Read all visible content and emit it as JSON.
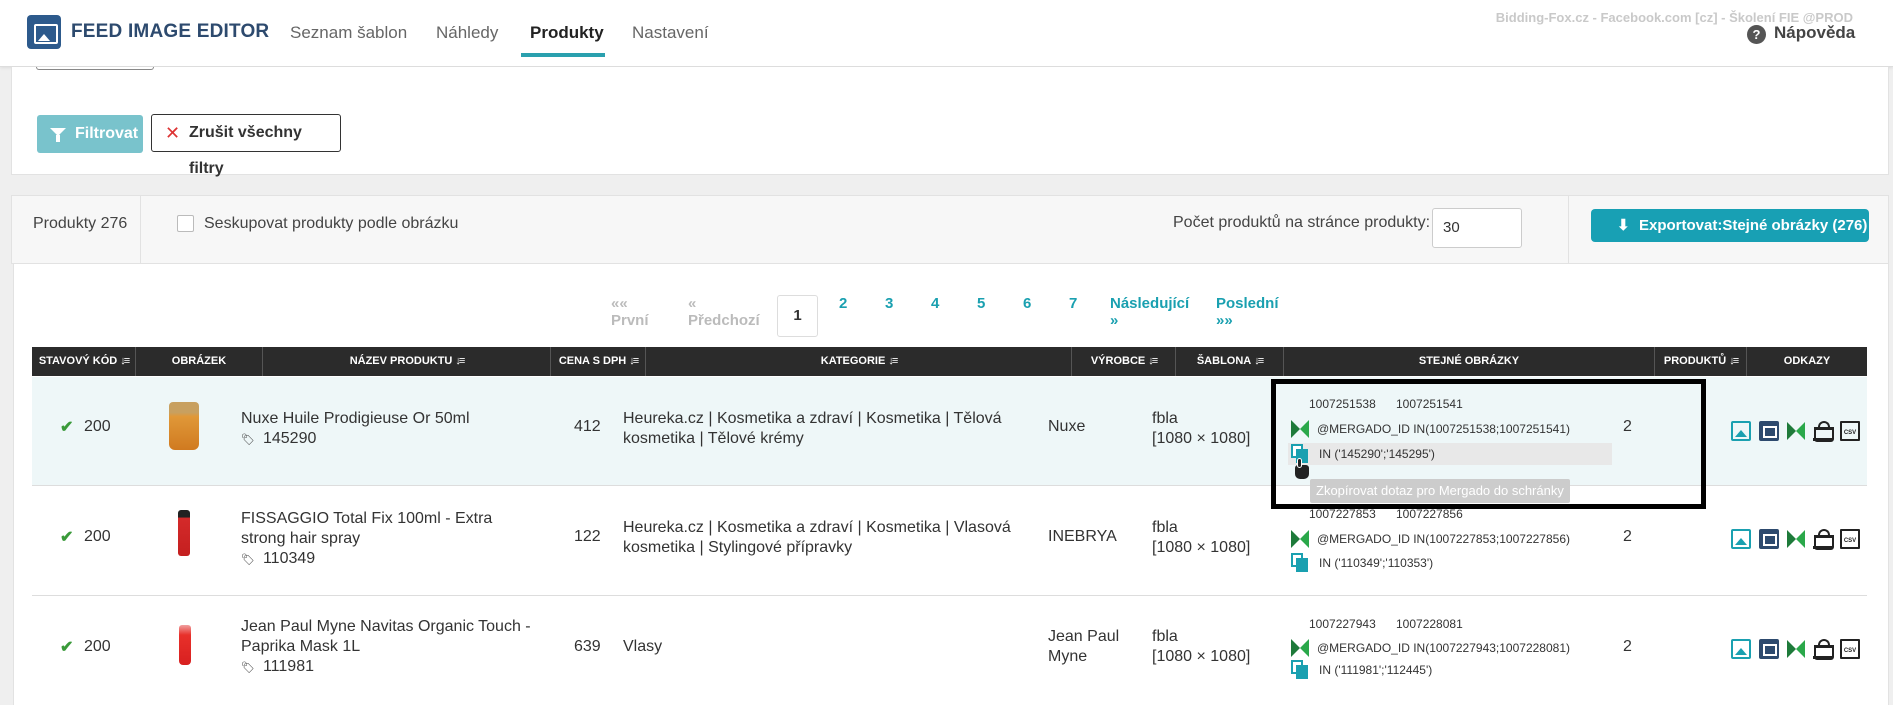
{
  "app": {
    "title": "FEED IMAGE EDITOR",
    "env": "Bidding-Fox.cz - Facebook.com [cz] - Školení FIE @PROD"
  },
  "nav": {
    "tabs": [
      "Seznam šablon",
      "Náhledy",
      "Produkty",
      "Nastavení"
    ],
    "active": "Produkty",
    "help": "Nápověda"
  },
  "filters": {
    "filter_button": "Filtrovat",
    "clear_button": "Zrušit všechny filtry"
  },
  "toolbar": {
    "products_count": "Produkty 276",
    "group_label": "Seskupovat produkty podle obrázku",
    "perpage_label": "Počet produktů na stránce produkty:",
    "perpage_value": "30",
    "export_button": "Exportovat:Stejné obrázky (276)"
  },
  "pager": {
    "first": "«« První",
    "prev": "« Předchozí",
    "current": "1",
    "pages": [
      "2",
      "3",
      "4",
      "5",
      "6",
      "7"
    ],
    "next": "Následující »",
    "last": "Poslední »»"
  },
  "table": {
    "headers": [
      "STAVOVÝ KÓD",
      "OBRÁZEK",
      "NÁZEV PRODUKTU",
      "CENA S DPH",
      "KATEGORIE",
      "VÝROBCE",
      "ŠABLONA",
      "STEJNÉ OBRÁZKY",
      "PRODUKTŮ",
      "ODKAZY"
    ],
    "rows": [
      {
        "status": "200",
        "name_line1": "Nuxe Huile Prodigieuse Or 50ml",
        "name_line2": "",
        "id": "145290",
        "price": "412",
        "cat_line1": "Heureka.cz | Kosmetika a zdraví | Kosmetika | Tělová",
        "cat_line2": "kosmetika | Tělové krémy",
        "maker_line1": "Nuxe",
        "maker_line2": "",
        "tpl_line1": "fbla",
        "tpl_line2": "[1080 × 1080]",
        "id_a": "1007251538",
        "id_b": "1007251541",
        "mergado": "@MERGADO_ID IN(1007251538;1007251541)",
        "in_query": "IN ('145290';'145295')",
        "count": "2",
        "thumb_color": "#d4882a"
      },
      {
        "status": "200",
        "name_line1": "FISSAGGIO Total Fix 100ml - Extra",
        "name_line2": "strong hair spray",
        "id": "110349",
        "price": "122",
        "cat_line1": "Heureka.cz | Kosmetika a zdraví | Kosmetika | Vlasová",
        "cat_line2": "kosmetika | Stylingové přípravky",
        "maker_line1": "INEBRYA",
        "maker_line2": "",
        "tpl_line1": "fbla",
        "tpl_line2": "[1080 × 1080]",
        "id_a": "1007227853",
        "id_b": "1007227856",
        "mergado": "@MERGADO_ID IN(1007227853;1007227856)",
        "in_query": "IN ('110349';'110353')",
        "count": "2",
        "thumb_color": "#d42a2a"
      },
      {
        "status": "200",
        "name_line1": "Jean Paul Myne Navitas Organic Touch -",
        "name_line2": "Paprika Mask 1L",
        "id": "111981",
        "price": "639",
        "cat_line1": "Vlasy",
        "cat_line2": "",
        "maker_line1": "Jean Paul",
        "maker_line2": "Myne",
        "tpl_line1": "fbla",
        "tpl_line2": "[1080 × 1080]",
        "id_a": "1007227943",
        "id_b": "1007228081",
        "mergado": "@MERGADO_ID IN(1007227943;1007228081)",
        "in_query": "IN ('111981';'112445')",
        "count": "2",
        "thumb_color": "#e8302a"
      }
    ]
  },
  "tooltip": "Zkopírovat dotaz pro Mergado do schránky",
  "colors": {
    "accent": "#1aa0b0",
    "brand": "#2d4a6e",
    "header": "#2b2b2b",
    "ok": "#3a9a3a"
  }
}
